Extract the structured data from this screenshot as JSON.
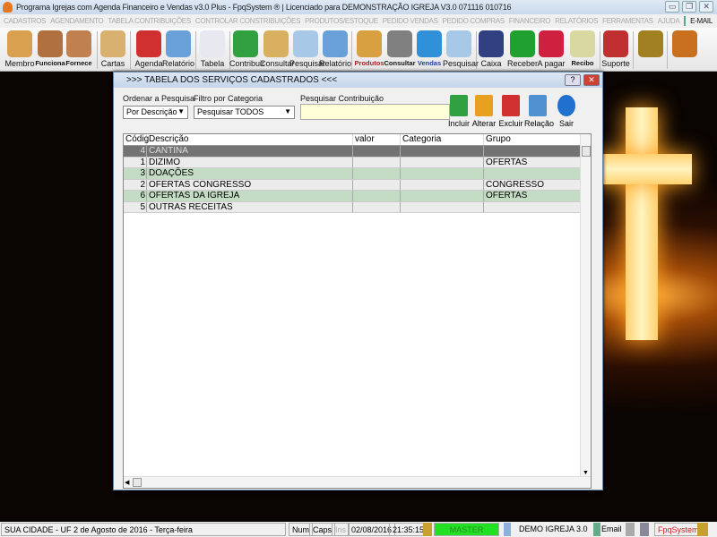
{
  "window": {
    "title": "Programa Igrejas com Agenda Financeiro e Vendas v3.0 Plus - FpqSystem ® | Licenciado para  DEMONSTRAÇÃO IGREJA V3.0 071116 010716",
    "min": "▭",
    "max": "❐",
    "close": "✕"
  },
  "menu": [
    "CADASTROS",
    "AGENDAMENTO",
    "TABELA CONTRIBUIÇÕES",
    "CONTROLAR CONSTRIBUIÇÕES",
    "PRODUTOS/ESTOQUE",
    "PEDIDO VENDAS",
    "PEDIDO COMPRAS",
    "FINANCEIRO",
    "RELATÓRIOS",
    "FERRAMENTAS",
    "AJUDA"
  ],
  "menu_email": "E-MAIL",
  "toolbar": [
    {
      "label": "Membro",
      "color": "#d9a050"
    },
    {
      "label": "Funciona",
      "color": "#b07040"
    },
    {
      "label": "Fornece",
      "color": "#c08050"
    },
    {
      "label": "Cartas",
      "color": "#d8b070"
    },
    {
      "label": "Agenda",
      "color": "#d03030"
    },
    {
      "label": "Relatório",
      "color": "#6aa0d8"
    },
    {
      "label": "Tabela",
      "color": "#e8e8f0"
    },
    {
      "label": "Contribuir",
      "color": "#30a040"
    },
    {
      "label": "Consultar",
      "color": "#d8b060"
    },
    {
      "label": "Pesquisar",
      "color": "#a8c8e8"
    },
    {
      "label": "Relatório",
      "color": "#6aa0d8"
    },
    {
      "label": "Produtos",
      "color": "#d8a040"
    },
    {
      "label": "Consultar",
      "color": "#808080"
    },
    {
      "label": "Vendas",
      "color": "#3090d8"
    },
    {
      "label": "Pesquisar",
      "color": "#a8c8e8"
    },
    {
      "label": "Caixa",
      "color": "#304080"
    },
    {
      "label": "Receber",
      "color": "#20a030"
    },
    {
      "label": "A pagar",
      "color": "#d02040"
    },
    {
      "label": "Recibo",
      "color": "#d8d8a0"
    },
    {
      "label": "Suporte",
      "color": "#c03030"
    },
    {
      "label": "",
      "color": "#a08020"
    },
    {
      "label": "",
      "color": "#c87020"
    }
  ],
  "dialog": {
    "title": ">>>  TABELA DOS SERVIÇOS CADASTRADOS  <<<",
    "help": "?",
    "close": "✕",
    "order_label": "Ordenar a Pesquisa",
    "order_value": "Por Descrição",
    "filter_label": "Filtro por Categoria",
    "filter_value": "Pesquisar TODOS",
    "search_label": "Pesquisar Contribuição",
    "search_value": "",
    "actions": [
      {
        "label": "Incluir",
        "color": "#30a040"
      },
      {
        "label": "Alterar",
        "color": "#e8a020"
      },
      {
        "label": "Excluir",
        "color": "#d03030"
      },
      {
        "label": "Relação",
        "color": "#5090d0"
      },
      {
        "label": "Sair",
        "color": "#2070d0"
      }
    ],
    "columns": [
      "Códig",
      "Descrição",
      "valor",
      "Categoria",
      "Grupo"
    ],
    "rows": [
      [
        "4",
        "CANTINA",
        "",
        "",
        ""
      ],
      [
        "1",
        "DIZIMO",
        "",
        "",
        "OFERTAS"
      ],
      [
        "3",
        "DOAÇÕES",
        "",
        "",
        ""
      ],
      [
        "2",
        "OFERTAS CONGRESSO",
        "",
        "",
        "CONGRESSO"
      ],
      [
        "6",
        "OFERTAS DA IGREJA",
        "",
        "",
        "OFERTAS"
      ],
      [
        "5",
        "OUTRAS RECEITAS",
        "",
        "",
        ""
      ]
    ]
  },
  "status": {
    "city": "SUA CIDADE - UF  2 de Agosto de 2016 - Terça-feira",
    "num": "Num",
    "caps": "Caps",
    "ins": "Ins",
    "date": "02/08/2016",
    "time": "21:35:15",
    "user": "MASTER",
    "company": "DEMO IGREJA 3.0",
    "email": "Email",
    "brand": "FpqSystem"
  }
}
